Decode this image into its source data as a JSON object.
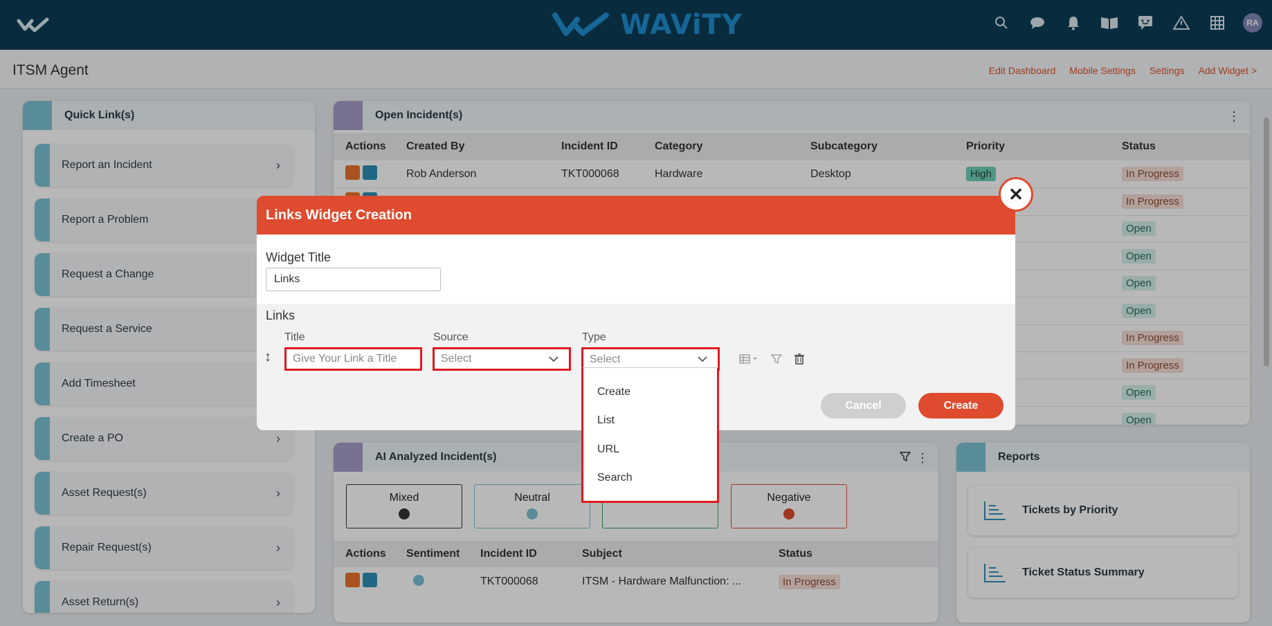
{
  "header": {
    "brand": "WAViTY",
    "avatar_initials": "RA",
    "icons": [
      "search-icon",
      "chat-icon",
      "bell-icon",
      "book-icon",
      "feedback-icon",
      "alert-icon",
      "grid-icon"
    ]
  },
  "subheader": {
    "title": "ITSM Agent",
    "actions": [
      "Edit Dashboard",
      "Mobile Settings",
      "Settings",
      "Add Widget >"
    ]
  },
  "quick_links": {
    "title": "Quick Link(s)",
    "items": [
      "Report an Incident",
      "Report a Problem",
      "Request a Change",
      "Request a Service",
      "Add Timesheet",
      "Create a PO",
      "Asset Request(s)",
      "Repair Request(s)",
      "Asset Return(s)"
    ]
  },
  "open_incidents": {
    "title": "Open Incident(s)",
    "columns": [
      "Actions",
      "Created By",
      "Incident ID",
      "Category",
      "Subcategory",
      "Priority",
      "Status"
    ],
    "rows": [
      {
        "created_by": "Rob Anderson",
        "incident_id": "TKT000068",
        "category": "Hardware",
        "subcategory": "Desktop",
        "priority": "High",
        "status": "In Progress"
      },
      {
        "created_by": "",
        "incident_id": "",
        "category": "",
        "subcategory": "",
        "priority": "",
        "status": "In Progress"
      },
      {
        "created_by": "",
        "incident_id": "",
        "category": "",
        "subcategory": "",
        "priority": "",
        "status": "Open"
      },
      {
        "created_by": "",
        "incident_id": "",
        "category": "",
        "subcategory": "",
        "priority": "",
        "status": "Open"
      },
      {
        "created_by": "",
        "incident_id": "",
        "category": "",
        "subcategory": "",
        "priority": "",
        "status": "Open"
      },
      {
        "created_by": "",
        "incident_id": "",
        "category": "",
        "subcategory": "",
        "priority": "",
        "status": "Open"
      },
      {
        "created_by": "",
        "incident_id": "",
        "category": "",
        "subcategory": "",
        "priority": "",
        "status": "In Progress"
      },
      {
        "created_by": "",
        "incident_id": "",
        "category": "",
        "subcategory": "",
        "priority": "",
        "status": "In Progress"
      },
      {
        "created_by": "",
        "incident_id": "",
        "category": "",
        "subcategory": "",
        "priority": "",
        "status": "Open"
      },
      {
        "created_by": "",
        "incident_id": "",
        "category": "",
        "subcategory": "",
        "priority": "",
        "status": "Open"
      }
    ]
  },
  "ai_incidents": {
    "title": "AI Analyzed Incident(s)",
    "sentiments": [
      "Mixed",
      "Neutral",
      "",
      "Negative"
    ],
    "columns": [
      "Actions",
      "Sentiment",
      "Incident ID",
      "Subject",
      "Status"
    ],
    "rows": [
      {
        "incident_id": "TKT000068",
        "subject": "ITSM - Hardware Malfunction: ...",
        "status": "In Progress"
      }
    ]
  },
  "reports": {
    "title": "Reports",
    "items": [
      "Tickets by Priority",
      "Ticket Status Summary"
    ]
  },
  "modal": {
    "title": "Links Widget Creation",
    "close_label": "✕",
    "widget_title_label": "Widget Title",
    "widget_title_value": "Links",
    "links_label": "Links",
    "col_title": "Title",
    "col_source": "Source",
    "col_type": "Type",
    "title_placeholder": "Give Your Link a Title",
    "source_value": "Select",
    "type_value": "Select",
    "type_options": [
      "Create",
      "List",
      "URL",
      "Search"
    ],
    "cancel_label": "Cancel",
    "create_label": "Create"
  },
  "colors": {
    "topbar": "#0c3c57",
    "brand_blue": "#1f8fd1",
    "accent_orange": "#de4b2e",
    "link_orange": "#d9552a",
    "quicklink_bar": "#7cc3d4",
    "highlight_red": "#e0191f"
  }
}
